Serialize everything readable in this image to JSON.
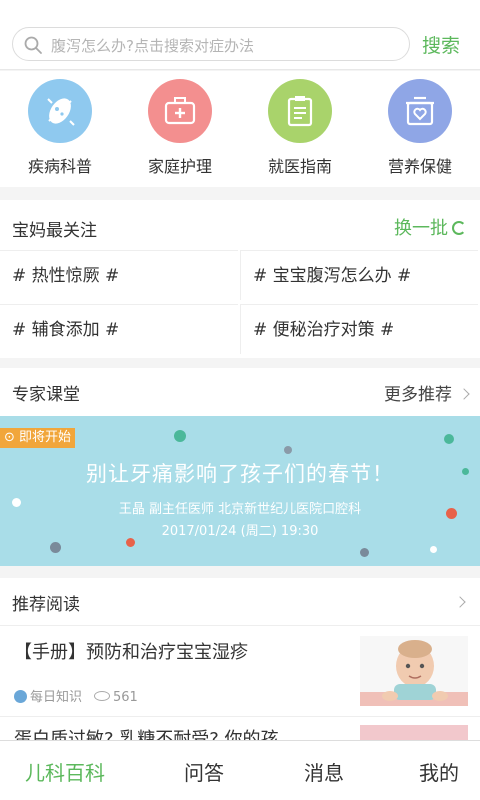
{
  "search": {
    "placeholder": "腹泻怎么办?点击搜索对症办法",
    "button": "搜索"
  },
  "categories": [
    {
      "label": "疾病科普",
      "icon": "germ-icon",
      "color": "#8fc9ef"
    },
    {
      "label": "家庭护理",
      "icon": "medical-kit-icon",
      "color": "#f38f8f"
    },
    {
      "label": "就医指南",
      "icon": "clipboard-icon",
      "color": "#a9d36b"
    },
    {
      "label": "营养保健",
      "icon": "food-box-icon",
      "color": "#8fa6e6"
    }
  ],
  "hot": {
    "title": "宝妈最关注",
    "refresh": "换一批",
    "tags": [
      "# 热性惊厥 #",
      "# 宝宝腹泻怎么办 #",
      "# 辅食添加 #",
      "# 便秘治疗对策 #"
    ]
  },
  "expert": {
    "title": "专家课堂",
    "more": "更多推荐",
    "banner": {
      "badge": "即将开始",
      "title": "别让牙痛影响了孩子们的春节！",
      "author": "王晶 副主任医师 北京新世纪儿医院口腔科",
      "time": "2017/01/24 (周二) 19:30"
    }
  },
  "reading": {
    "title": "推荐阅读",
    "articles": [
      {
        "title": "【手册】预防和治疗宝宝湿疹",
        "source": "每日知识",
        "views": "561"
      },
      {
        "title": "蛋白质过敏? 乳糖不耐受? 你的孩"
      }
    ]
  },
  "tabs": [
    "儿科百科",
    "问答",
    "消息",
    "我的"
  ],
  "colors": {
    "accent": "#5cb85c",
    "banner_bg": "#a9dde8",
    "badge": "#f1a63b"
  }
}
